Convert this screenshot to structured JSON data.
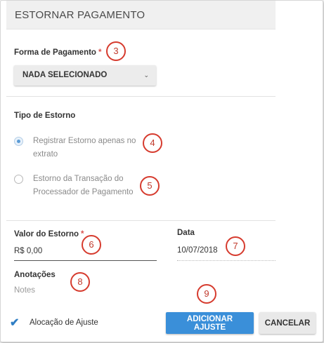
{
  "header": {
    "title": "ESTORNAR PAGAMENTO"
  },
  "payment_method": {
    "label": "Forma de Pagamento",
    "required_mark": "*",
    "selected": "NADA SELECIONADO"
  },
  "refund_type": {
    "label": "Tipo de Estorno",
    "options": [
      {
        "line1": "Registrar Estorno apenas no",
        "line2": "extrato",
        "selected": true
      },
      {
        "line1": "Estorno da Transação do",
        "line2": "Processador de Pagamento",
        "selected": false
      }
    ]
  },
  "refund_value": {
    "label": "Valor do Estorno",
    "required_mark": "*",
    "value": "R$ 0,00"
  },
  "date": {
    "label": "Data",
    "value": "10/07/2018"
  },
  "notes": {
    "label": "Anotações",
    "placeholder": "Notes"
  },
  "adjustment_allocation": {
    "label": "Alocação de Ajuste",
    "checked": true
  },
  "actions": {
    "primary": "ADICIONAR AJUSTE",
    "secondary": "CANCELAR"
  },
  "callouts": [
    "3",
    "4",
    "5",
    "6",
    "7",
    "8",
    "9"
  ],
  "colors": {
    "accent": "#3a8fd9",
    "callout": "#d63b2e",
    "required": "#d9534f"
  }
}
